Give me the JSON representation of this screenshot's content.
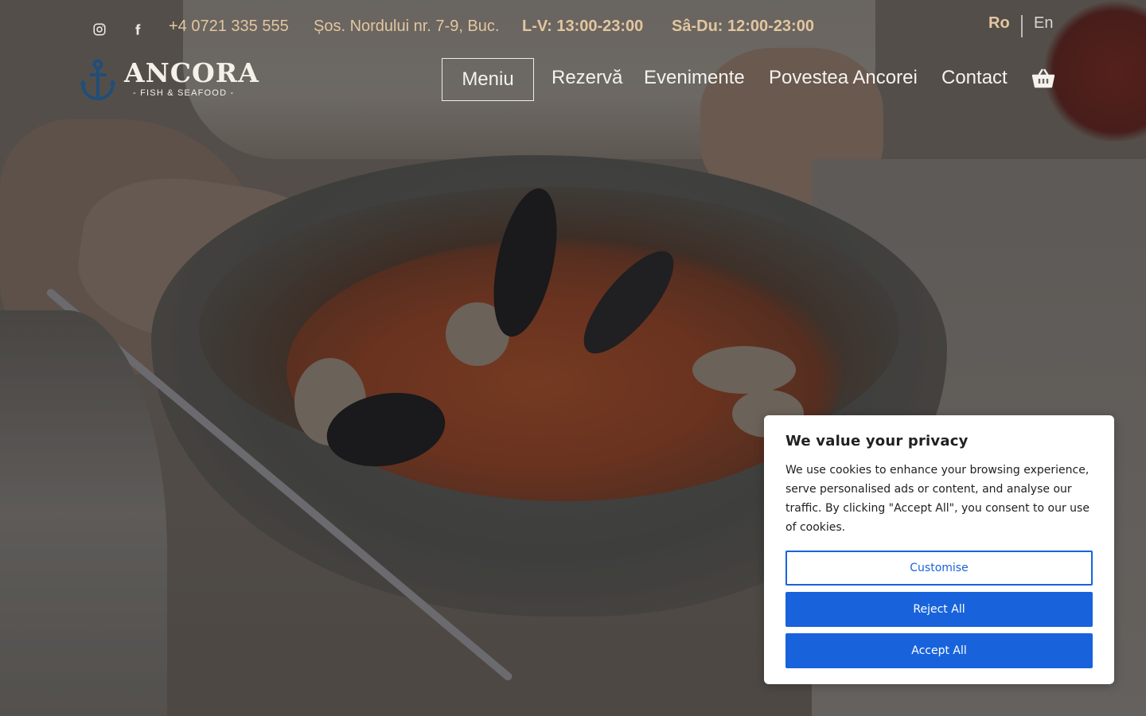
{
  "colors": {
    "gold_accent": "#e3c69f",
    "nav_text": "#f5f2ee",
    "cookie_primary": "#1863dc",
    "anchor_blue": "#1f4e7a"
  },
  "topbar": {
    "social": [
      {
        "icon": "instagram-icon"
      },
      {
        "icon": "facebook-icon"
      }
    ],
    "phone": "+4 0721 335 555",
    "address": "Șos. Nordului nr. 7-9, Buc.",
    "hours_weekdays": "L-V: 13:00-23:00",
    "hours_weekend": "Sâ-Du: 12:00-23:00",
    "languages": [
      {
        "label": "Ro",
        "active": true
      },
      {
        "label": "En",
        "active": false
      }
    ]
  },
  "logo": {
    "name": "ANCORA",
    "tagline": "- FISH & SEAFOOD -",
    "icon": "anchor-icon"
  },
  "nav": {
    "items": [
      {
        "label": "Meniu",
        "highlighted": true
      },
      {
        "label": "Rezervă"
      },
      {
        "label": "Evenimente"
      },
      {
        "label": "Povestea Ancorei"
      },
      {
        "label": "Contact"
      }
    ],
    "cart_icon": "basket-icon"
  },
  "cookie_banner": {
    "title": "We value your privacy",
    "text": "We use cookies to enhance your browsing experience, serve personalised ads or content, and analyse our traffic. By clicking \"Accept All\", you consent to our use of cookies.",
    "buttons": {
      "customise": "Customise",
      "reject": "Reject All",
      "accept": "Accept All"
    }
  }
}
